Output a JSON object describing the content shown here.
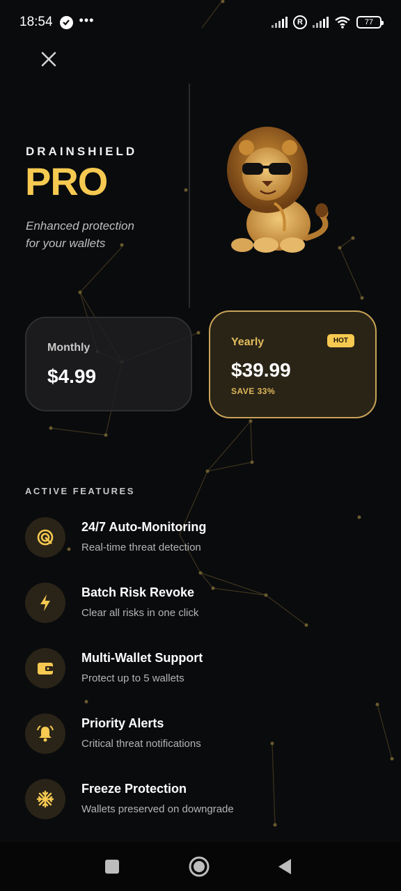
{
  "status_bar": {
    "time": "18:54",
    "more": "•••",
    "roaming": "R",
    "battery": "77",
    "icons": [
      "check-circle-icon",
      "signal-icon",
      "roaming-icon",
      "signal-icon",
      "wifi-icon",
      "battery-icon"
    ]
  },
  "header": {
    "close_icon": "close-icon"
  },
  "hero": {
    "brand": "DRAINSHIELD",
    "tier": "PRO",
    "tagline_line1": "Enhanced protection",
    "tagline_line2": "for your wallets",
    "mascot": "lion-with-sunglasses-mascot"
  },
  "plans": [
    {
      "name": "Monthly",
      "price": "$4.99"
    },
    {
      "name": "Yearly",
      "price": "$39.99",
      "save": "SAVE 33%",
      "badge": "HOT",
      "selected": true
    }
  ],
  "features": {
    "title": "ACTIVE FEATURES",
    "items": [
      {
        "title": "24/7 Auto-Monitoring",
        "desc": "Real-time threat detection",
        "icon": "radar-icon"
      },
      {
        "title": "Batch Risk Revoke",
        "desc": "Clear all risks in one click",
        "icon": "bolt-icon"
      },
      {
        "title": "Multi-Wallet Support",
        "desc": "Protect up to 5 wallets",
        "icon": "wallet-icon"
      },
      {
        "title": "Priority Alerts",
        "desc": "Critical threat notifications",
        "icon": "bell-icon"
      },
      {
        "title": "Freeze Protection",
        "desc": "Wallets preserved on downgrade",
        "icon": "snowflake-icon"
      }
    ]
  },
  "navbar": {
    "buttons": [
      "recents-square-icon",
      "home-circle-icon",
      "back-triangle-icon"
    ]
  },
  "colors": {
    "background": "#0a0b0d",
    "accent_gold": "#f6c951",
    "selected_plan_border": "#c9a457",
    "icon_circle": "#2a2418"
  }
}
